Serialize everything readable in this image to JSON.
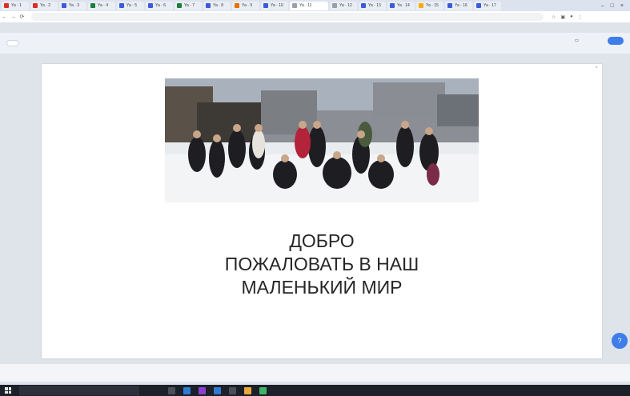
{
  "browser": {
    "tabs": [
      {
        "label": "Ya · 1",
        "color": "#d93025"
      },
      {
        "label": "Ya · 2",
        "color": "#d93025"
      },
      {
        "label": "Ya · 3",
        "color": "#3b5bdb"
      },
      {
        "label": "Ya · 4",
        "color": "#188038"
      },
      {
        "label": "Ya · 5",
        "color": "#3b5bdb"
      },
      {
        "label": "Ya · 6",
        "color": "#3b5bdb"
      },
      {
        "label": "Ya · 7",
        "color": "#188038"
      },
      {
        "label": "Ya · 8",
        "color": "#3b5bdb"
      },
      {
        "label": "Ya · 9",
        "color": "#e37400"
      },
      {
        "label": "Ya · 10",
        "color": "#3b5bdb"
      },
      {
        "label": "Ya · 11",
        "color": "#9aa0a6"
      },
      {
        "label": "Ya · 12",
        "color": "#9aa0a6"
      },
      {
        "label": "Ya · 13",
        "color": "#3b5bdb"
      },
      {
        "label": "Ya · 14",
        "color": "#3b5bdb"
      },
      {
        "label": "Ya · 15",
        "color": "#f9ab00"
      },
      {
        "label": "Ya · 16",
        "color": "#3b5bdb"
      },
      {
        "label": "Ya · 17",
        "color": "#3b5bdb"
      }
    ],
    "active_tab_label": "× ",
    "address": ""
  },
  "toolbar": {
    "left_pill": "",
    "items": [
      "",
      "",
      "",
      "",
      ""
    ],
    "center_title": "",
    "right_items": [
      "",
      "",
      ""
    ],
    "publish_label": ""
  },
  "canvas": {
    "breadcrumb_pre": "",
    "breadcrumb_accent": "",
    "welcome_lines": [
      "ДОБРО",
      "ПОЖАЛОВАТЬ В НАШ",
      "МАЛЕНЬКИЙ МИР"
    ],
    "desc_lines": [
      "",
      "",
      ""
    ]
  },
  "bottombar": {
    "left": "",
    "right": ""
  },
  "taskbar": {
    "search_placeholder": "",
    "tray": ""
  },
  "help_fab_label": "?",
  "colors": {
    "accent": "#3f7de8",
    "breadcrumb_accent": "#c2185b",
    "taskbar": "#1b2029"
  }
}
